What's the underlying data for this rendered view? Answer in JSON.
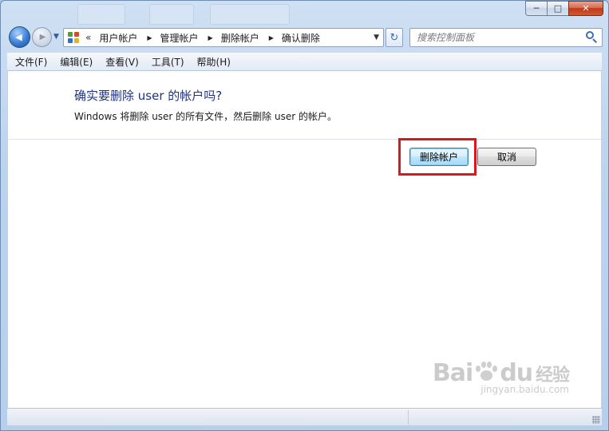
{
  "window": {
    "caption": {
      "minimize": "─",
      "maximize": "□",
      "close": "✕"
    }
  },
  "navigation": {
    "back_glyph": "◀",
    "forward_glyph": "▶",
    "recent_glyph": "▼",
    "address": {
      "icon": "control-panel-icon",
      "overflow": "«",
      "separator": "▶",
      "breadcrumbs": [
        "用户帐户",
        "管理帐户",
        "删除帐户",
        "确认删除"
      ],
      "dropdown_glyph": "▼"
    },
    "refresh_glyph": "↻",
    "search": {
      "placeholder": "搜索控制面板",
      "icon": "search-icon"
    }
  },
  "menubar": {
    "items": [
      "文件(F)",
      "编辑(E)",
      "查看(V)",
      "工具(T)",
      "帮助(H)"
    ]
  },
  "content": {
    "heading": "确实要删除 user 的帐户吗?",
    "description": "Windows 将删除 user 的所有文件，然后删除 user 的帐户。",
    "buttons": {
      "delete_account": "删除帐户",
      "cancel": "取消"
    },
    "highlight_color": "#d9171e"
  },
  "watermark": {
    "logo_left": "Bai",
    "logo_right": "du",
    "logo_suffix": "经验",
    "url": "jingyan.baidu.com"
  }
}
